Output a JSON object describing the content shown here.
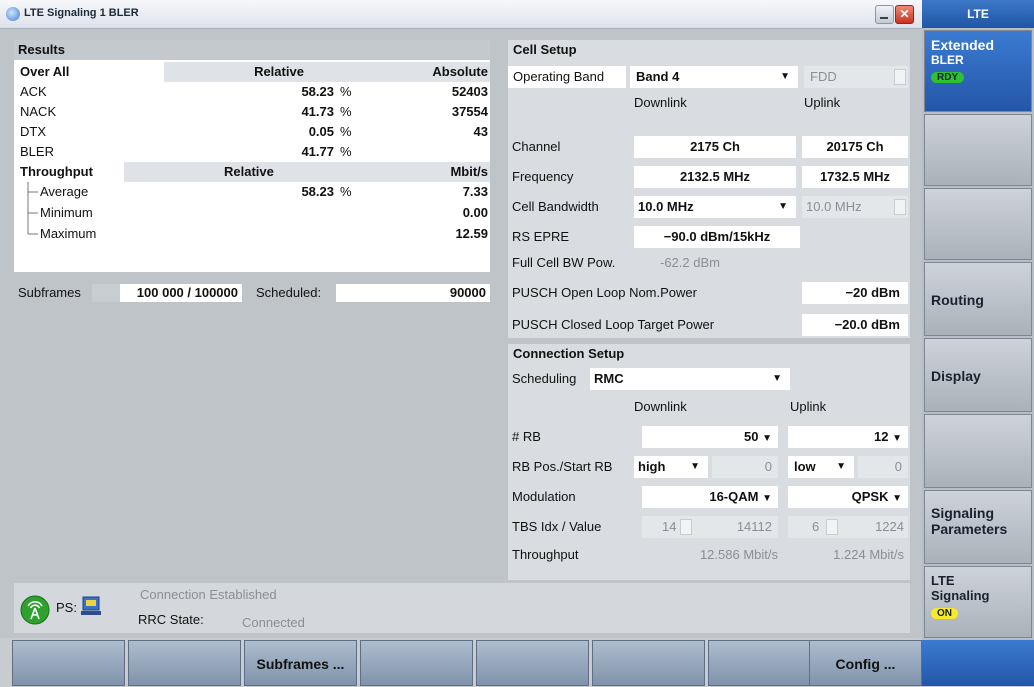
{
  "window": {
    "title": "LTE Signaling 1 BLER"
  },
  "results": {
    "heading": "Results",
    "overall": {
      "label": "Over All",
      "relative_hdr": "Relative",
      "absolute_hdr": "Absolute"
    },
    "rows": [
      {
        "label": "ACK",
        "relative": "58.23",
        "unit": "%",
        "absolute": "52403"
      },
      {
        "label": "NACK",
        "relative": "41.73",
        "unit": "%",
        "absolute": "37554"
      },
      {
        "label": "DTX",
        "relative": "0.05",
        "unit": "%",
        "absolute": "43"
      },
      {
        "label": "BLER",
        "relative": "41.77",
        "unit": "%",
        "absolute": ""
      }
    ],
    "throughput": {
      "label": "Throughput",
      "relative_hdr": "Relative",
      "unit_hdr": "Mbit/s"
    },
    "tp_rows": [
      {
        "label": "Average",
        "relative": "58.23",
        "unit": "%",
        "value": "7.33"
      },
      {
        "label": "Minimum",
        "relative": "",
        "unit": "",
        "value": "0.00"
      },
      {
        "label": "Maximum",
        "relative": "",
        "unit": "",
        "value": "12.59"
      }
    ]
  },
  "subframes": {
    "label": "Subframes",
    "value": "100 000 / 100000",
    "scheduled_label": "Scheduled:",
    "scheduled_value": "90000"
  },
  "cell_setup": {
    "heading": "Cell Setup",
    "operating_band_label": "Operating Band",
    "operating_band_value": "Band 4",
    "duplex_value": "FDD",
    "downlink_hdr": "Downlink",
    "uplink_hdr": "Uplink",
    "channel_label": "Channel",
    "channel_dl": "2175  Ch",
    "channel_ul": "20175  Ch",
    "frequency_label": "Frequency",
    "frequency_dl": "2132.5  MHz",
    "frequency_ul": "1732.5  MHz",
    "bandwidth_label": "Cell Bandwidth",
    "bandwidth_dl": "10.0 MHz",
    "bandwidth_ul": "10.0 MHz",
    "rs_epre_label": "RS EPRE",
    "rs_epre_value": "−90.0  dBm/15kHz",
    "full_bw_label": "Full Cell BW Pow.",
    "full_bw_value": "-62.2  dBm",
    "pusch_open_label": "PUSCH Open Loop Nom.Power",
    "pusch_open_value": "−20  dBm",
    "pusch_closed_label": "PUSCH Closed Loop Target Power",
    "pusch_closed_value": "−20.0  dBm"
  },
  "connection_setup": {
    "heading": "Connection Setup",
    "scheduling_label": "Scheduling",
    "scheduling_value": "RMC",
    "downlink_hdr": "Downlink",
    "uplink_hdr": "Uplink",
    "rb_label": "# RB",
    "rb_dl": "50",
    "rb_ul": "12",
    "rbpos_label": "RB Pos./Start RB",
    "rbpos_dl": "high",
    "rbpos_dl_num": "0",
    "rbpos_ul": "low",
    "rbpos_ul_num": "0",
    "mod_label": "Modulation",
    "mod_dl": "16-QAM",
    "mod_ul": "QPSK",
    "tbs_label": "TBS Idx / Value",
    "tbs_dl_idx": "14",
    "tbs_dl_val": "14112",
    "tbs_ul_idx": "6",
    "tbs_ul_val": "1224",
    "tp_label": "Throughput",
    "tp_dl": "12.586  Mbit/s",
    "tp_ul": "1.224  Mbit/s"
  },
  "status": {
    "ps_label": "PS:",
    "connection": "Connection Established",
    "rrc_label": "RRC State:",
    "rrc_value": "Connected"
  },
  "softkeys": [
    "",
    "",
    "Subframes ...",
    "",
    "",
    "",
    "",
    "Config ..."
  ],
  "side": {
    "header": "LTE",
    "extended": "Extended",
    "bler": "BLER",
    "rdy": "RDY",
    "routing": "Routing",
    "display": "Display",
    "signaling_params_1": "Signaling",
    "signaling_params_2": "Parameters",
    "lte_sig_1": "LTE",
    "lte_sig_2": "Signaling",
    "on": "ON"
  },
  "colors": {
    "accent": "#2456a8",
    "rdy_badge": "#2fc230",
    "on_badge": "#f7e92a"
  }
}
